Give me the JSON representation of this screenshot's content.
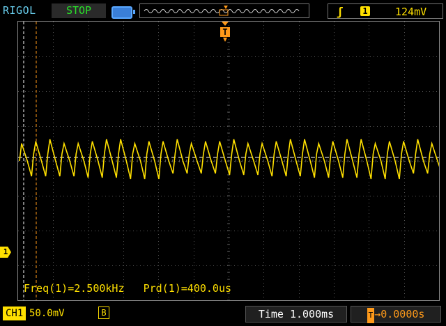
{
  "header": {
    "brand": "RIGOL",
    "run_state": "STOP",
    "trigger": {
      "edge_icon": "rising-edge-icon",
      "source": "1",
      "level": "124mV"
    }
  },
  "measurements": {
    "freq": "Freq(1)=2.500kHz",
    "period": "Prd(1)=400.0us"
  },
  "footer": {
    "channel_label": "CH1",
    "channel_scale": "50.0mV",
    "bandwidth_mark": "B",
    "timebase": "Time 1.000ms",
    "trigger_position": "0.0000s"
  },
  "markers": {
    "channel": "1",
    "trigger_t": "T"
  },
  "colors": {
    "trace": "#ffe000",
    "trigger": "#ff9a1a",
    "grid": "#5a5a5a",
    "run": "#29e229"
  }
}
